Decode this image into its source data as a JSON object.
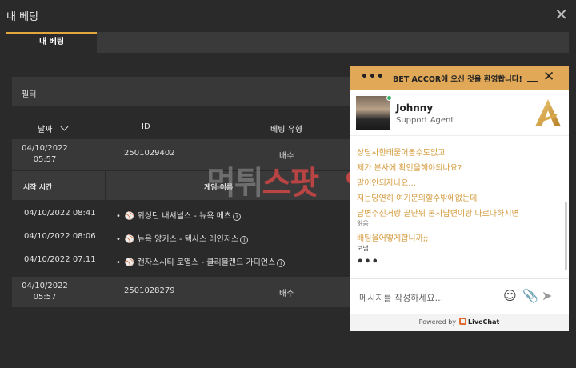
{
  "window": {
    "title": "내 베팅"
  },
  "tabs": [
    {
      "label": "내 베팅",
      "active": true
    }
  ],
  "filter": {
    "label": "필터"
  },
  "table": {
    "headers": {
      "date": "날짜",
      "id": "ID",
      "bet_type": "베팅 유형"
    },
    "bets": [
      {
        "date_line1": "04/10/2022",
        "date_line2": "05:57",
        "id": "2501029402",
        "odds": "배수"
      },
      {
        "date_line1": "04/10/2022",
        "date_line2": "05:57",
        "id": "2501028279",
        "odds": "배수"
      }
    ],
    "sub_headers": {
      "start_time": "시작 시간",
      "game_name": "게임 이름"
    },
    "games": [
      {
        "time": "04/10/2022 08:41",
        "name": "위싱턴 내셔널스 - 뉴욕 메츠"
      },
      {
        "time": "04/10/2022 08:06",
        "name": "뉴욕 양키스 - 텍사스 레인저스"
      },
      {
        "time": "04/10/2022 07:11",
        "name": "캔자스시티 로열스 - 클리블랜드 가디언스"
      }
    ]
  },
  "watermark": {
    "part1": "먹튀",
    "part2": "스팟"
  },
  "chat": {
    "header_title": "BET ACCOR에 오신 것을 환영합니다!",
    "agent": {
      "name": "Johnny",
      "role": "Support Agent"
    },
    "messages": [
      {
        "text": "상담사한테물어볼수도없고"
      },
      {
        "text": "제가 본사에 확인을해야되나요?"
      },
      {
        "text": "말이안되자나요..."
      },
      {
        "text": "저는당연히 여기문의할수밖에없는데"
      },
      {
        "text": "답변주신거랑 끝난뒤 본사답변이랑 다르다하시면"
      }
    ],
    "status1": "읽음",
    "message_last": "배팅을어떻게합니까;;",
    "status2": "보냄",
    "typing": "•••",
    "input_placeholder": "메시지를 작성하세요...",
    "powered_by": "Powered by",
    "brand": "LiveChat",
    "accent_color": "#e0a857"
  }
}
